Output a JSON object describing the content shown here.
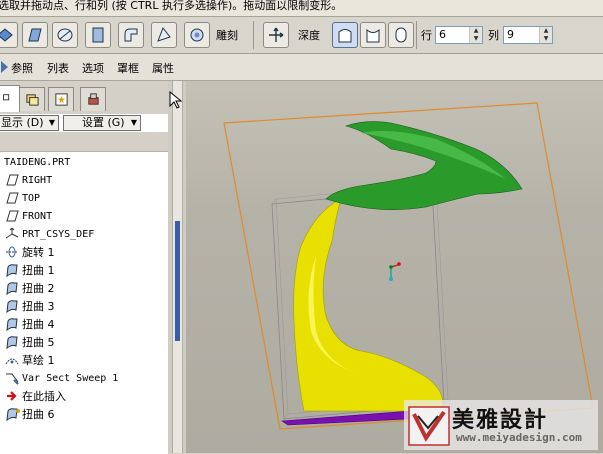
{
  "status_hint": "选取并拖动点、行和列 (按 CTRL 执行多选操作)。拖动面以限制变形。",
  "toolbar": {
    "warp_label": "雕刻",
    "depth_label": "深度",
    "rows_label": "行",
    "rows_value": "6",
    "cols_label": "列",
    "cols_value": "9"
  },
  "menu": {
    "items": [
      "参照",
      "列表",
      "选项",
      "罩框",
      "属性"
    ]
  },
  "panel": {
    "display_label": "显示 (D)",
    "settings_label": "设置 (G)",
    "tree": [
      "TAIDENG.PRT",
      "RIGHT",
      "TOP",
      "FRONT",
      "PRT_CSYS_DEF",
      "旋转 1",
      "扭曲 1",
      "扭曲 2",
      "扭曲 3",
      "扭曲 4",
      "扭曲 5",
      "草绘 1",
      "Var Sect Sweep 1",
      "在此插入",
      "扭曲 6"
    ]
  },
  "watermark": {
    "brand": "美雅設計",
    "url": "www.meiyadesign.com"
  },
  "colors": {
    "model_yellow": "#e8e000",
    "model_green": "#2a9a2a",
    "model_purple": "#7a10b0",
    "bbox_orange": "#e08a2a"
  }
}
